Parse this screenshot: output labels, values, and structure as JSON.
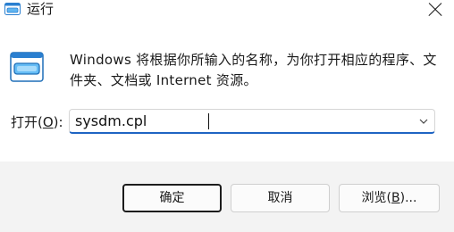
{
  "window": {
    "title": "运行"
  },
  "description": "Windows 将根据你所输入的名称，为你打开相应的程序、文件夹、文档或 Internet 资源。",
  "open_field": {
    "label_prefix": "打开(",
    "label_accel": "O",
    "label_suffix": "):",
    "value": "sysdm.cpl"
  },
  "buttons": {
    "ok": "确定",
    "cancel": "取消",
    "browse_prefix": "浏览(",
    "browse_accel": "B",
    "browse_suffix": ")..."
  },
  "icons": {
    "title": "run-app-icon",
    "large": "run-app-icon",
    "close": "close-icon",
    "dropdown": "chevron-down-icon"
  }
}
